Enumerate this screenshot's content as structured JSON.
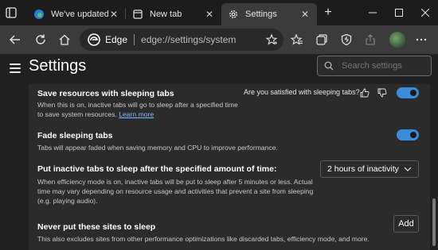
{
  "tabs": [
    {
      "title": "We've updated you",
      "active": false
    },
    {
      "title": "New tab",
      "active": false
    },
    {
      "title": "Settings",
      "active": true
    }
  ],
  "addressbar": {
    "brand": "Edge",
    "url": "edge://settings/system"
  },
  "settings": {
    "title": "Settings",
    "search_placeholder": "Search settings"
  },
  "sections": {
    "sleeping_tabs": {
      "title": "Save resources with sleeping tabs",
      "desc_line1": "When this is on, inactive tabs will go to sleep after a specified time",
      "desc_line2": "to save system resources.",
      "link": "Learn more",
      "feedback_question": "Are you satisfied with sleeping tabs?",
      "enabled": true
    },
    "fade_tabs": {
      "title": "Fade sleeping tabs",
      "desc": "Tabs will appear faded when saving memory and CPU to improve performance.",
      "enabled": true
    },
    "inactive_time": {
      "title": "Put inactive tabs to sleep after the specified amount of time:",
      "desc_line1": "When efficiency mode is on, inactive tabs will be put to sleep after 5 minutes or less. Actual",
      "desc_line2": "time may vary depending on resource usage and activities that prevent a site from sleeping",
      "desc_line3": "(e.g. playing audio).",
      "selected": "2 hours of inactivity"
    },
    "never_sleep": {
      "title": "Never put these sites to sleep",
      "desc": "This also excludes sites from other performance optimizations like discarded tabs, efficiency mode, and more.",
      "add_label": "Add"
    }
  },
  "colors": {
    "accent": "#3b8cd8",
    "link": "#7db8ff"
  }
}
